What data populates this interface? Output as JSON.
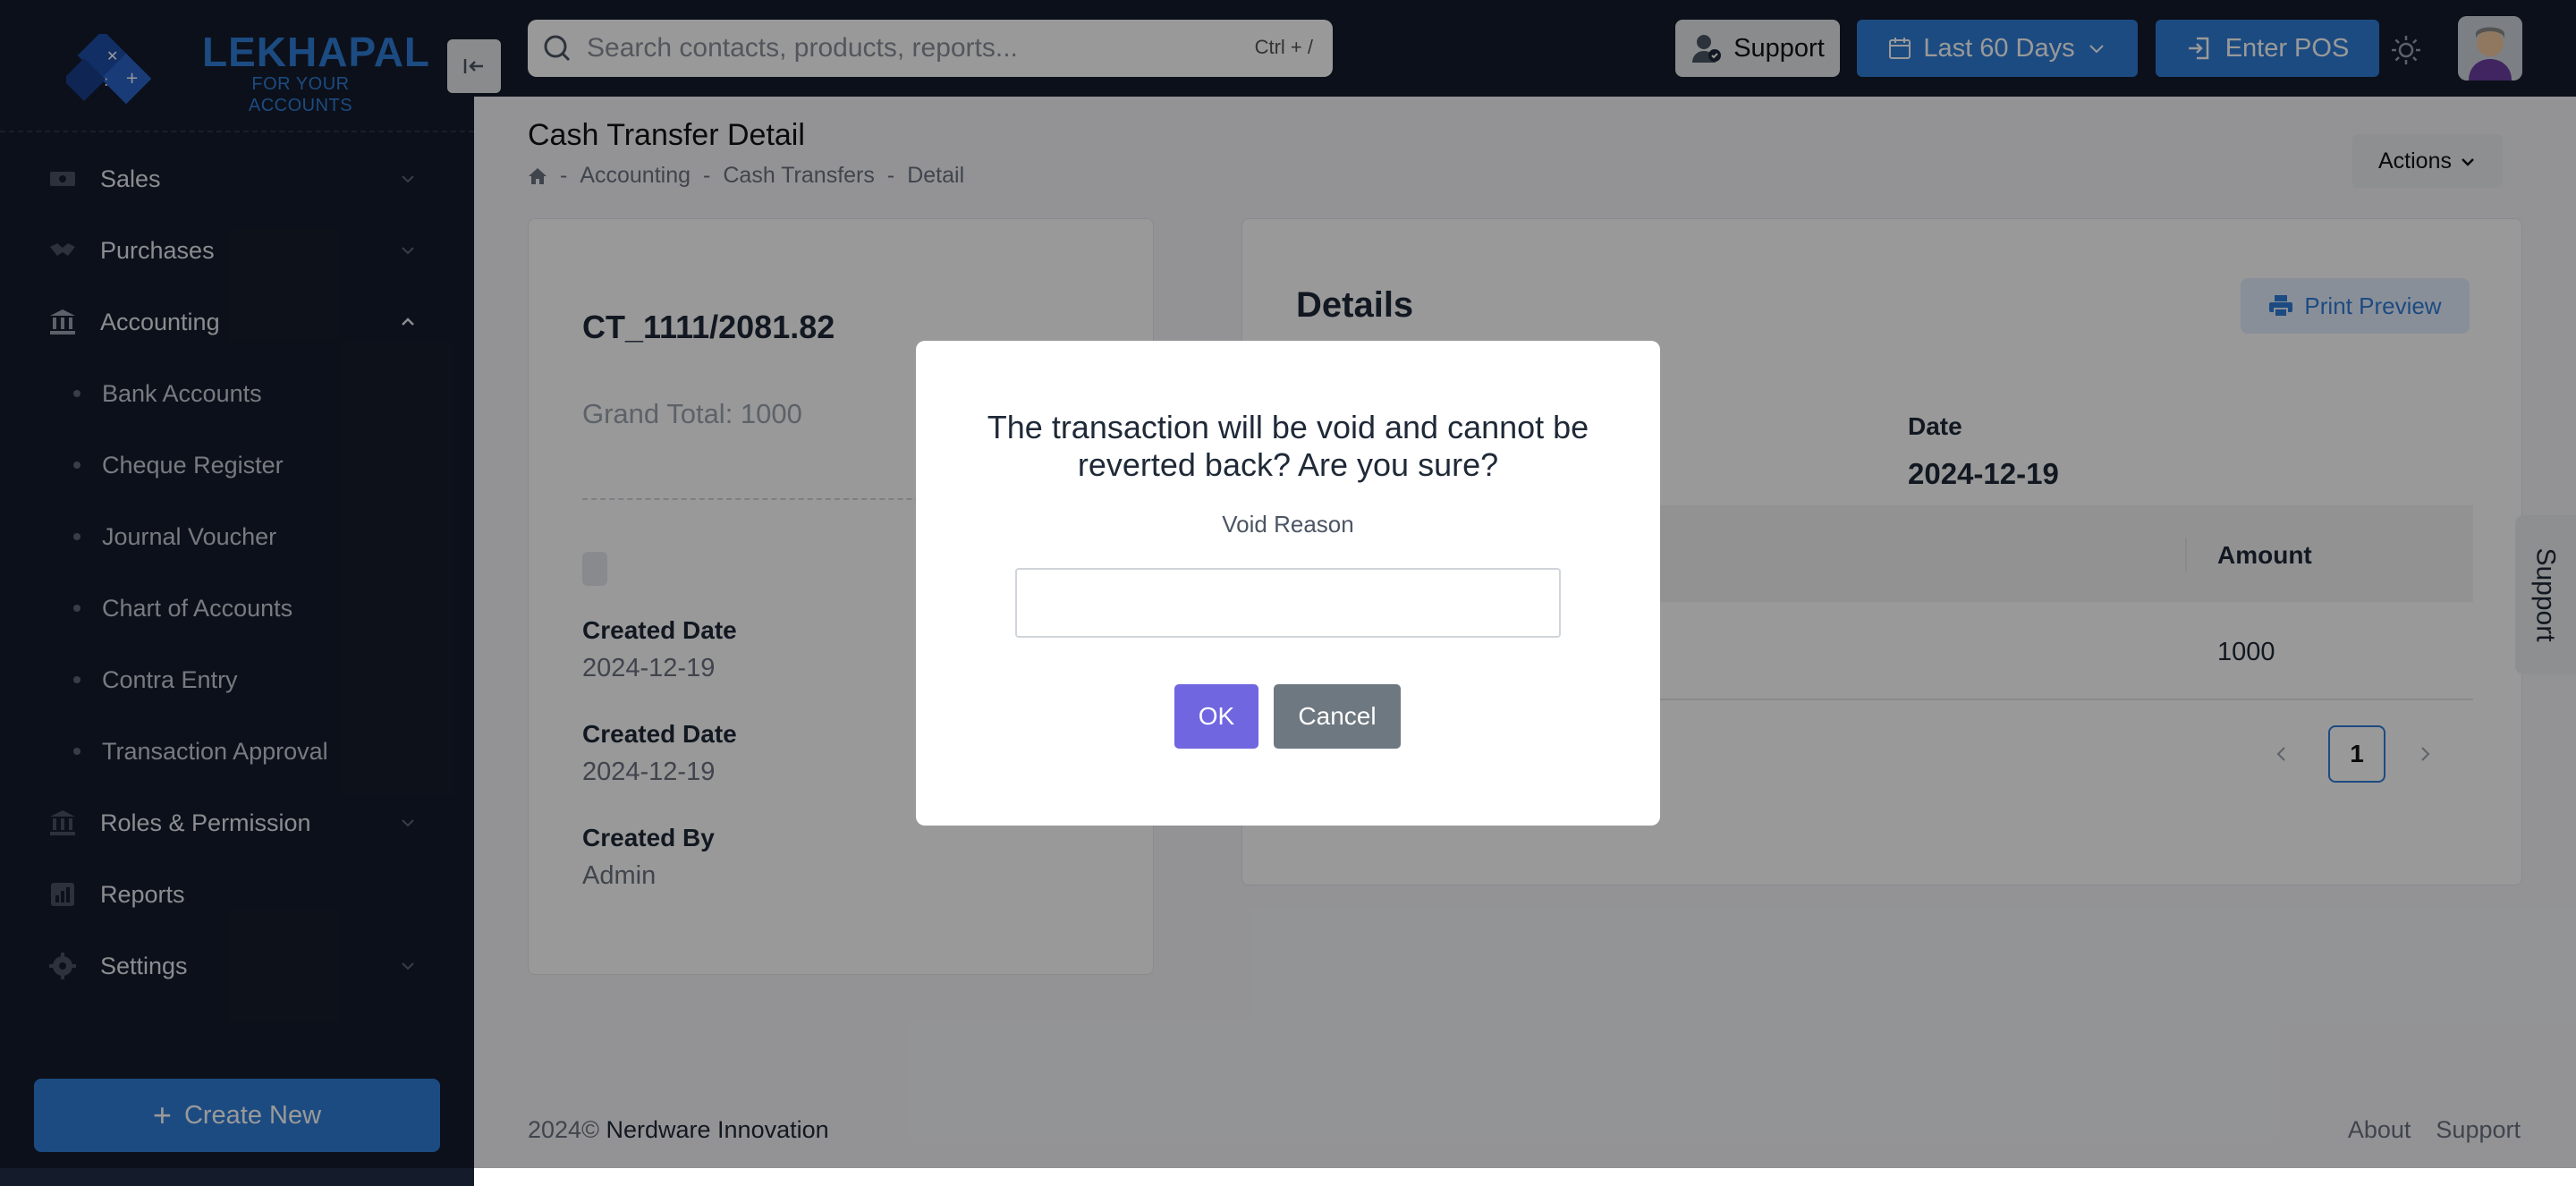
{
  "brand": {
    "title": "LEKHAPAL",
    "tagline": "FOR YOUR ACCOUNTS"
  },
  "sidebar": {
    "items": [
      {
        "label": "Sales"
      },
      {
        "label": "Purchases"
      },
      {
        "label": "Accounting"
      },
      {
        "label": "Roles & Permission"
      },
      {
        "label": "Reports"
      },
      {
        "label": "Settings"
      }
    ],
    "accounting_sub": [
      {
        "label": "Bank Accounts"
      },
      {
        "label": "Cheque Register"
      },
      {
        "label": "Journal Voucher"
      },
      {
        "label": "Chart of Accounts"
      },
      {
        "label": "Contra Entry"
      },
      {
        "label": "Transaction Approval"
      }
    ],
    "create_new": "Create New"
  },
  "header": {
    "search_placeholder": "Search contacts, products, reports...",
    "search_shortcut": "Ctrl + /",
    "support": "Support",
    "date_range": "Last 60 Days",
    "enter_pos": "Enter POS"
  },
  "page": {
    "title": "Cash Transfer Detail",
    "breadcrumb": [
      "Accounting",
      "Cash Transfers",
      "Detail"
    ],
    "actions": "Actions"
  },
  "summary": {
    "number": "CT_1111/2081.82",
    "grand_total": "Grand Total: 1000",
    "created_date_label_1": "Created Date",
    "created_date_1": "2024-12-19",
    "created_date_label_2": "Created Date",
    "created_date_2": "2024-12-19",
    "created_by_label": "Created By",
    "created_by": "Admin"
  },
  "details": {
    "title": "Details",
    "print_preview": "Print Preview",
    "date_label": "Date",
    "date_value": "2024-12-19",
    "table_headers": [
      "Amount"
    ],
    "rows": [
      {
        "amount": "1000"
      }
    ],
    "current_page": "1"
  },
  "support_tab": "Support",
  "footer": {
    "year": "2024©",
    "company": "Nerdware Innovation",
    "links": [
      "About",
      "Support"
    ]
  },
  "modal": {
    "title": "The transaction will be void and cannot be reverted back? Are you sure?",
    "label": "Void Reason",
    "input_value": "",
    "ok": "OK",
    "cancel": "Cancel"
  },
  "colors": {
    "sidebar_bg": "#141c2c",
    "primary": "#2f7ed8",
    "ok_button": "#7066e0",
    "cancel_button": "#6e7881"
  }
}
